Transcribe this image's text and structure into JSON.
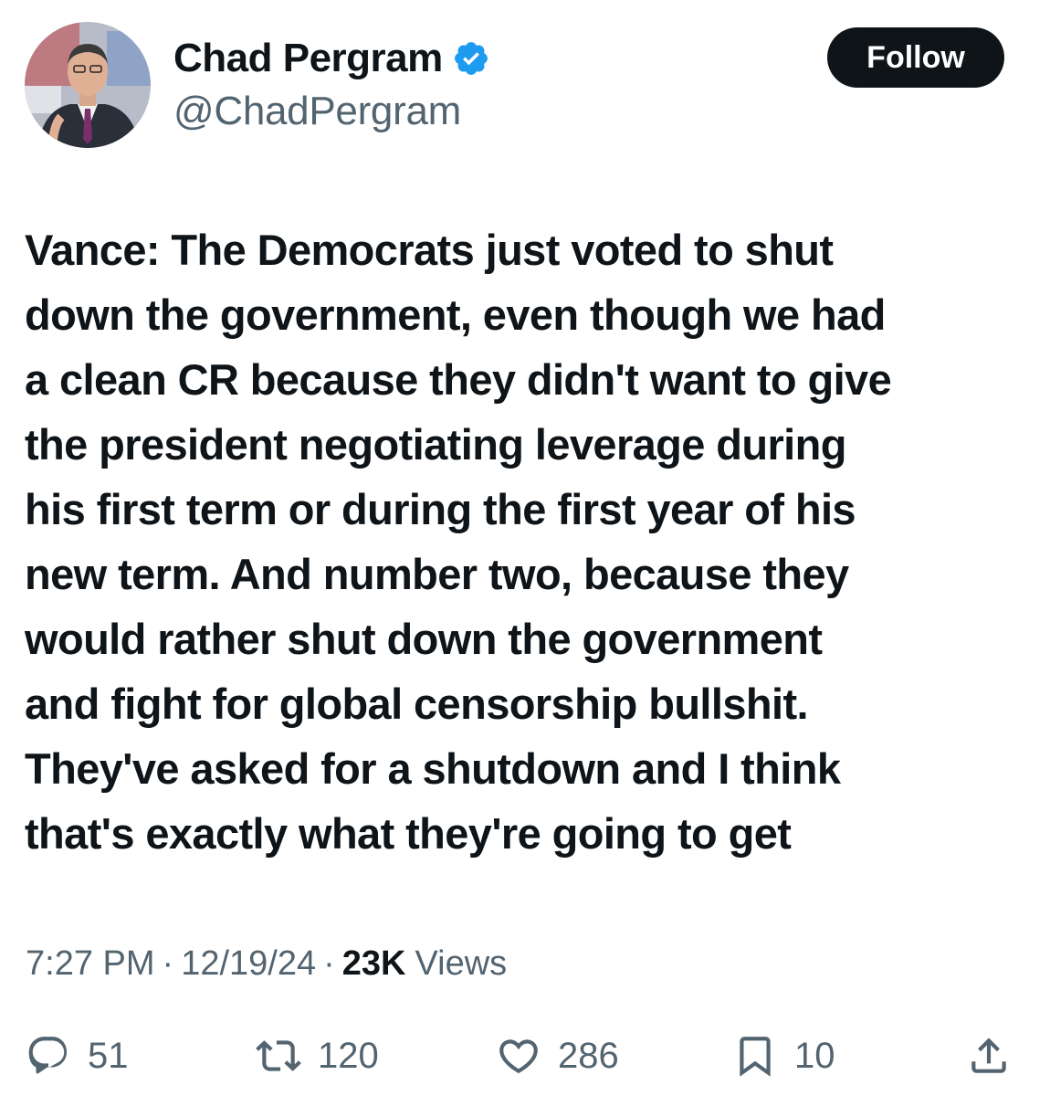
{
  "author": {
    "display_name": "Chad Pergram",
    "handle": "@ChadPergram",
    "verified_color": "#1d9bf0"
  },
  "follow_button": {
    "label": "Follow"
  },
  "tweet": {
    "text": "Vance: The Democrats just voted to shut\ndown the government, even though we had\na clean CR because they didn't want to give\nthe president negotiating leverage during\nhis first term or during the first year of his\nnew term. And number two, because they\nwould rather shut down the government\nand fight for global censorship bullshit.\nThey've asked for a shutdown and I think\nthat's exactly what they're going to get"
  },
  "meta": {
    "time": "7:27 PM",
    "separator": "·",
    "date": "12/19/24",
    "views_count": "23K",
    "views_label": "Views"
  },
  "actions": {
    "replies": {
      "icon": "reply-icon",
      "count": "51"
    },
    "reposts": {
      "icon": "repost-icon",
      "count": "120"
    },
    "likes": {
      "icon": "heart-icon",
      "count": "286"
    },
    "bookmarks": {
      "icon": "bookmark-icon",
      "count": "10"
    },
    "share": {
      "icon": "share-icon"
    }
  },
  "colors": {
    "text_primary": "#0f1419",
    "text_secondary": "#536471",
    "follow_bg": "#0f1419",
    "verified": "#1d9bf0"
  }
}
